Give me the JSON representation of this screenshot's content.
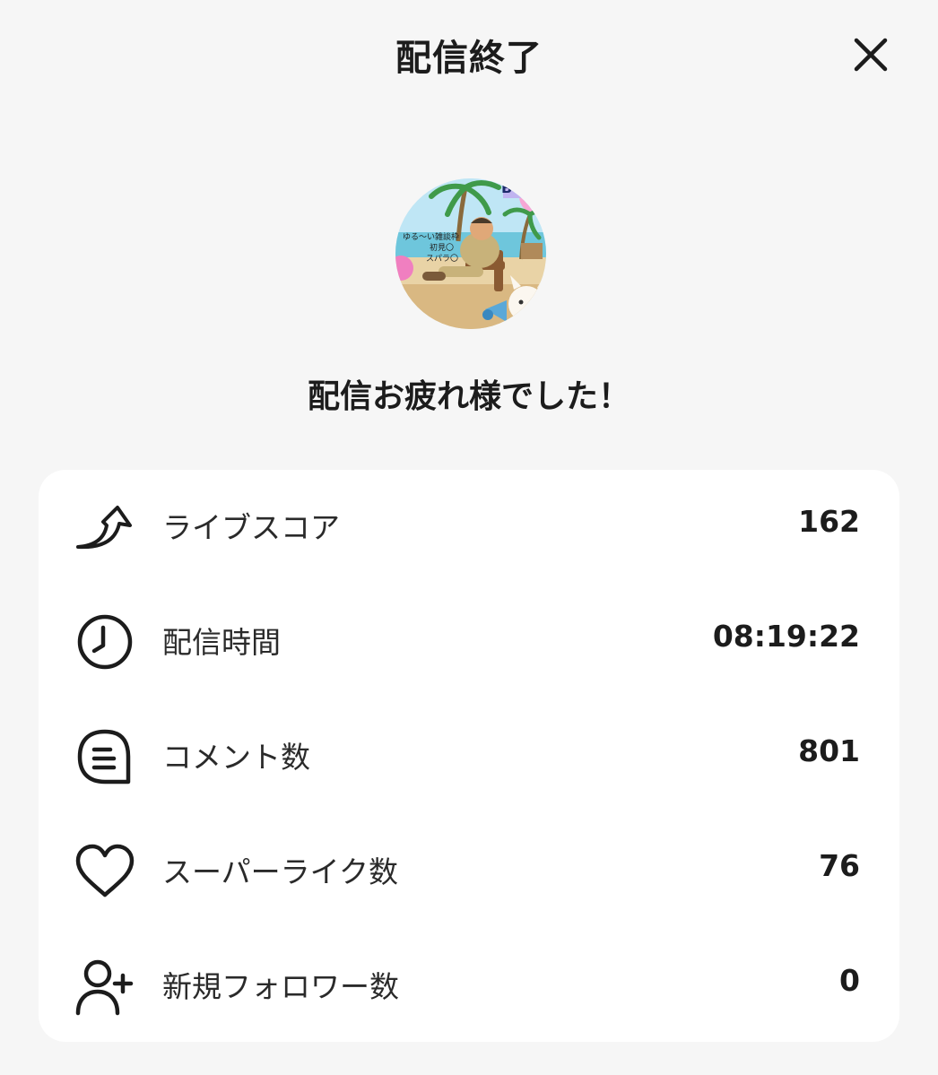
{
  "header": {
    "title": "配信終了"
  },
  "avatar": {
    "overlay_lines": [
      "ゆる〜い雑談枠",
      "初見〇",
      "スパラ〇"
    ],
    "badge_text": "B"
  },
  "message": "配信お疲れ様でした！",
  "stats": [
    {
      "icon": "trending-up-arrow-icon",
      "label": "ライブスコア",
      "value": "162"
    },
    {
      "icon": "clock-icon",
      "label": "配信時間",
      "value": "08:19:22"
    },
    {
      "icon": "comment-icon",
      "label": "コメント数",
      "value": "801"
    },
    {
      "icon": "heart-icon",
      "label": "スーパーライク数",
      "value": "76"
    },
    {
      "icon": "add-user-icon",
      "label": "新規フォロワー数",
      "value": "0"
    }
  ]
}
